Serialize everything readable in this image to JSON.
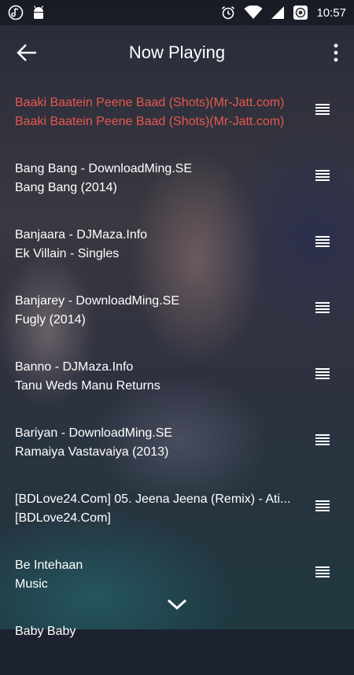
{
  "status_bar": {
    "time": "10:57",
    "left_icons": [
      "music-note-icon",
      "android-icon"
    ],
    "right_icons": [
      "alarm-icon",
      "wifi-icon",
      "signal-icon",
      "record-icon"
    ]
  },
  "app_bar": {
    "title": "Now Playing",
    "back_icon": "arrow-left-icon",
    "menu_icon": "more-vertical-icon"
  },
  "colors": {
    "active": "#e8584e"
  },
  "tracks": [
    {
      "title": "Baaki Baatein Peene Baad (Shots)(Mr-Jatt.com)",
      "subtitle": "Baaki Baatein Peene Baad (Shots)(Mr-Jatt.com)",
      "active": true
    },
    {
      "title": "Bang Bang - DownloadMing.SE",
      "subtitle": "Bang Bang (2014)"
    },
    {
      "title": "Banjaara - DJMaza.Info",
      "subtitle": "Ek Villain - Singles"
    },
    {
      "title": "Banjarey - DownloadMing.SE",
      "subtitle": "Fugly (2014)"
    },
    {
      "title": "Banno - DJMaza.Info",
      "subtitle": "Tanu Weds Manu Returns"
    },
    {
      "title": "Bariyan - DownloadMing.SE",
      "subtitle": "Ramaiya Vastavaiya (2013)"
    },
    {
      "title": "[BDLove24.Com] 05. Jeena Jeena (Remix) - Ati...",
      "subtitle": "[BDLove24.Com]"
    },
    {
      "title": "Be Intehaan",
      "subtitle": "Music"
    },
    {
      "title": "Baby Baby",
      "subtitle": ""
    }
  ],
  "collapse_icon": "chevron-down-icon"
}
